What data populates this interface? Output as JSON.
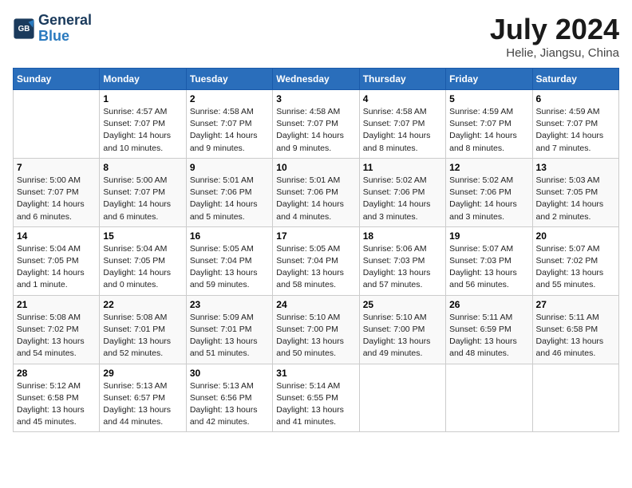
{
  "header": {
    "logo_line1": "General",
    "logo_line2": "Blue",
    "title": "July 2024",
    "subtitle": "Helie, Jiangsu, China"
  },
  "weekdays": [
    "Sunday",
    "Monday",
    "Tuesday",
    "Wednesday",
    "Thursday",
    "Friday",
    "Saturday"
  ],
  "weeks": [
    [
      {
        "day": "",
        "sunrise": "",
        "sunset": "",
        "daylight": ""
      },
      {
        "day": "1",
        "sunrise": "4:57 AM",
        "sunset": "7:07 PM",
        "daylight": "14 hours and 10 minutes."
      },
      {
        "day": "2",
        "sunrise": "4:58 AM",
        "sunset": "7:07 PM",
        "daylight": "14 hours and 9 minutes."
      },
      {
        "day": "3",
        "sunrise": "4:58 AM",
        "sunset": "7:07 PM",
        "daylight": "14 hours and 9 minutes."
      },
      {
        "day": "4",
        "sunrise": "4:58 AM",
        "sunset": "7:07 PM",
        "daylight": "14 hours and 8 minutes."
      },
      {
        "day": "5",
        "sunrise": "4:59 AM",
        "sunset": "7:07 PM",
        "daylight": "14 hours and 8 minutes."
      },
      {
        "day": "6",
        "sunrise": "4:59 AM",
        "sunset": "7:07 PM",
        "daylight": "14 hours and 7 minutes."
      }
    ],
    [
      {
        "day": "7",
        "sunrise": "5:00 AM",
        "sunset": "7:07 PM",
        "daylight": "14 hours and 6 minutes."
      },
      {
        "day": "8",
        "sunrise": "5:00 AM",
        "sunset": "7:07 PM",
        "daylight": "14 hours and 6 minutes."
      },
      {
        "day": "9",
        "sunrise": "5:01 AM",
        "sunset": "7:06 PM",
        "daylight": "14 hours and 5 minutes."
      },
      {
        "day": "10",
        "sunrise": "5:01 AM",
        "sunset": "7:06 PM",
        "daylight": "14 hours and 4 minutes."
      },
      {
        "day": "11",
        "sunrise": "5:02 AM",
        "sunset": "7:06 PM",
        "daylight": "14 hours and 3 minutes."
      },
      {
        "day": "12",
        "sunrise": "5:02 AM",
        "sunset": "7:06 PM",
        "daylight": "14 hours and 3 minutes."
      },
      {
        "day": "13",
        "sunrise": "5:03 AM",
        "sunset": "7:05 PM",
        "daylight": "14 hours and 2 minutes."
      }
    ],
    [
      {
        "day": "14",
        "sunrise": "5:04 AM",
        "sunset": "7:05 PM",
        "daylight": "14 hours and 1 minute."
      },
      {
        "day": "15",
        "sunrise": "5:04 AM",
        "sunset": "7:05 PM",
        "daylight": "14 hours and 0 minutes."
      },
      {
        "day": "16",
        "sunrise": "5:05 AM",
        "sunset": "7:04 PM",
        "daylight": "13 hours and 59 minutes."
      },
      {
        "day": "17",
        "sunrise": "5:05 AM",
        "sunset": "7:04 PM",
        "daylight": "13 hours and 58 minutes."
      },
      {
        "day": "18",
        "sunrise": "5:06 AM",
        "sunset": "7:03 PM",
        "daylight": "13 hours and 57 minutes."
      },
      {
        "day": "19",
        "sunrise": "5:07 AM",
        "sunset": "7:03 PM",
        "daylight": "13 hours and 56 minutes."
      },
      {
        "day": "20",
        "sunrise": "5:07 AM",
        "sunset": "7:02 PM",
        "daylight": "13 hours and 55 minutes."
      }
    ],
    [
      {
        "day": "21",
        "sunrise": "5:08 AM",
        "sunset": "7:02 PM",
        "daylight": "13 hours and 54 minutes."
      },
      {
        "day": "22",
        "sunrise": "5:08 AM",
        "sunset": "7:01 PM",
        "daylight": "13 hours and 52 minutes."
      },
      {
        "day": "23",
        "sunrise": "5:09 AM",
        "sunset": "7:01 PM",
        "daylight": "13 hours and 51 minutes."
      },
      {
        "day": "24",
        "sunrise": "5:10 AM",
        "sunset": "7:00 PM",
        "daylight": "13 hours and 50 minutes."
      },
      {
        "day": "25",
        "sunrise": "5:10 AM",
        "sunset": "7:00 PM",
        "daylight": "13 hours and 49 minutes."
      },
      {
        "day": "26",
        "sunrise": "5:11 AM",
        "sunset": "6:59 PM",
        "daylight": "13 hours and 48 minutes."
      },
      {
        "day": "27",
        "sunrise": "5:11 AM",
        "sunset": "6:58 PM",
        "daylight": "13 hours and 46 minutes."
      }
    ],
    [
      {
        "day": "28",
        "sunrise": "5:12 AM",
        "sunset": "6:58 PM",
        "daylight": "13 hours and 45 minutes."
      },
      {
        "day": "29",
        "sunrise": "5:13 AM",
        "sunset": "6:57 PM",
        "daylight": "13 hours and 44 minutes."
      },
      {
        "day": "30",
        "sunrise": "5:13 AM",
        "sunset": "6:56 PM",
        "daylight": "13 hours and 42 minutes."
      },
      {
        "day": "31",
        "sunrise": "5:14 AM",
        "sunset": "6:55 PM",
        "daylight": "13 hours and 41 minutes."
      },
      {
        "day": "",
        "sunrise": "",
        "sunset": "",
        "daylight": ""
      },
      {
        "day": "",
        "sunrise": "",
        "sunset": "",
        "daylight": ""
      },
      {
        "day": "",
        "sunrise": "",
        "sunset": "",
        "daylight": ""
      }
    ]
  ]
}
